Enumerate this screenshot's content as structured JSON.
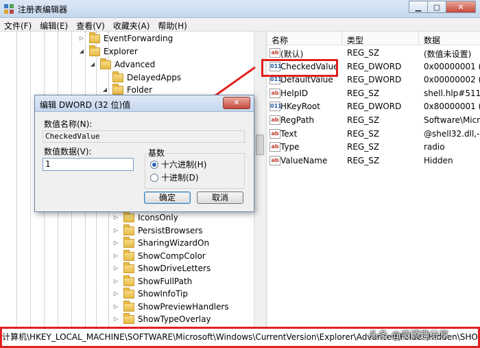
{
  "window": {
    "title": "注册表编辑器",
    "minimize": "▁",
    "maximize": "▢",
    "close": "✕"
  },
  "menu": [
    "文件(F)",
    "编辑(E)",
    "查看(V)",
    "收藏夹(A)",
    "帮助(H)"
  ],
  "tree": {
    "top_items": [
      {
        "label": "EventForwarding",
        "expanded": false
      },
      {
        "label": "Explorer",
        "expanded": true
      },
      {
        "label": "Advanced",
        "expanded": true
      },
      {
        "label": "DelayedApps",
        "expanded": false
      },
      {
        "label": "Folder",
        "expanded": true
      }
    ],
    "bottom_items": [
      {
        "label": "IconsOnly"
      },
      {
        "label": "PersistBrowsers"
      },
      {
        "label": "SharingWizardOn"
      },
      {
        "label": "ShowCompColor"
      },
      {
        "label": "ShowDriveLetters"
      },
      {
        "label": "ShowFullPath"
      },
      {
        "label": "ShowInfoTip"
      },
      {
        "label": "ShowPreviewHandlers"
      },
      {
        "label": "ShowTypeOverlay"
      }
    ]
  },
  "list": {
    "columns": [
      "名称",
      "类型",
      "数据"
    ],
    "rows": [
      {
        "icon": "ab",
        "name": "(默认)",
        "type": "REG_SZ",
        "data": "(数值未设置)"
      },
      {
        "icon": "dw",
        "name": "CheckedValue",
        "type": "REG_DWORD",
        "data": "0x00000001 (1)"
      },
      {
        "icon": "dw",
        "name": "DefaultValue",
        "type": "REG_DWORD",
        "data": "0x00000002 (2)"
      },
      {
        "icon": "ab",
        "name": "HelpID",
        "type": "REG_SZ",
        "data": "shell.hlp#51105"
      },
      {
        "icon": "dw",
        "name": "HKeyRoot",
        "type": "REG_DWORD",
        "data": "0x80000001 (2"
      },
      {
        "icon": "ab",
        "name": "RegPath",
        "type": "REG_SZ",
        "data": "Software\\Micro"
      },
      {
        "icon": "ab",
        "name": "Text",
        "type": "REG_SZ",
        "data": "@shell32.dll,-30"
      },
      {
        "icon": "ab",
        "name": "Type",
        "type": "REG_SZ",
        "data": "radio"
      },
      {
        "icon": "ab",
        "name": "ValueName",
        "type": "REG_SZ",
        "data": "Hidden"
      }
    ]
  },
  "dialog": {
    "title": "编辑 DWORD (32 位)值",
    "close": "✕",
    "name_label": "数值名称(N):",
    "name_value": "CheckedValue",
    "data_label": "数值数据(V):",
    "data_value": "1",
    "base_label": "基数",
    "hex_label": "十六进制(H)",
    "dec_label": "十进制(D)",
    "base_selected": "hex",
    "ok_label": "确定",
    "cancel_label": "取消"
  },
  "status": {
    "path": "计算机\\HKEY_LOCAL_MACHINE\\SOFTWARE\\Microsoft\\Windows\\CurrentVersion\\Explorer\\Advanced\\Folder\\Hidden\\SHOWALL"
  },
  "watermark": "头条 @资源趣分享",
  "colors": {
    "annotation_red": "#e02020",
    "selection_radio": "#2a62b0"
  }
}
